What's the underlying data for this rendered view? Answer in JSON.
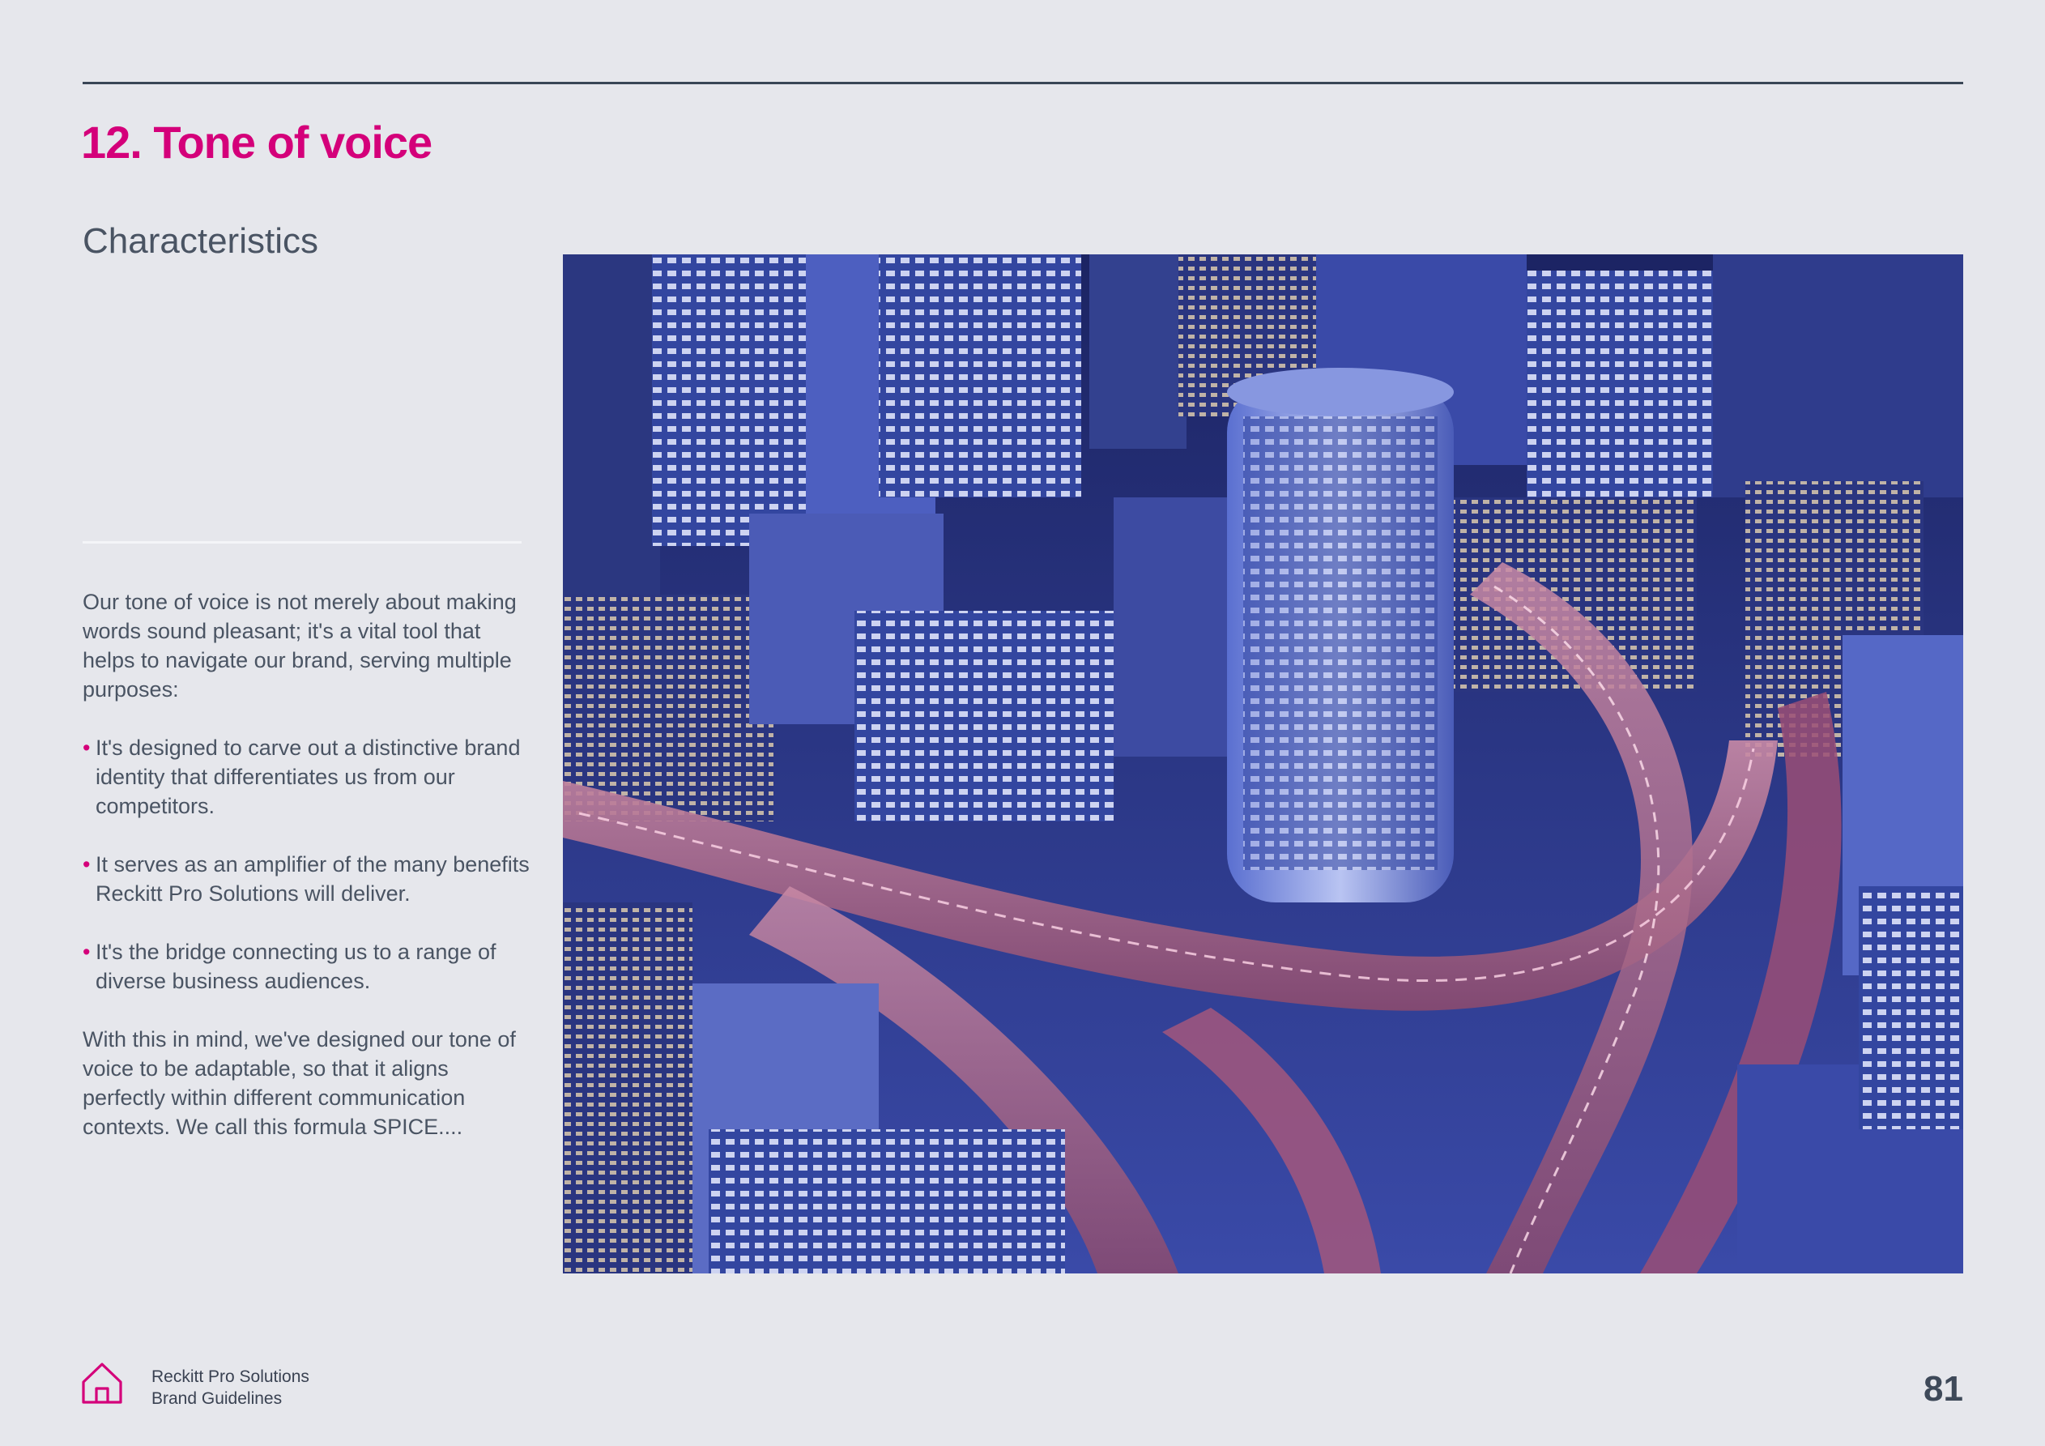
{
  "page": {
    "section_title": "12. Tone of voice",
    "subtitle": "Characteristics",
    "intro": "Our tone of voice is not merely about making words sound pleasant; it's a vital tool that helps to navigate our brand, serving multiple purposes:",
    "bullets": [
      "It's designed to carve out a distinctive brand identity that differentiates us from our competitors.",
      "It serves as an amplifier of the many benefits Reckitt Pro Solutions will deliver.",
      "It's the bridge connecting us to a range of diverse business audiences."
    ],
    "conclusion": "With this in mind, we've designed our tone of voice to be adaptable, so that it aligns perfectly within different communication contexts. We call this formula SPICE...."
  },
  "footer": {
    "brand_line1": "Reckitt Pro Solutions",
    "brand_line2": "Brand Guidelines",
    "page_number": "81",
    "logo_icon": "house-icon"
  },
  "colors": {
    "accent": "#d4007a",
    "text": "#4a5463",
    "background": "#e6e7ec"
  }
}
